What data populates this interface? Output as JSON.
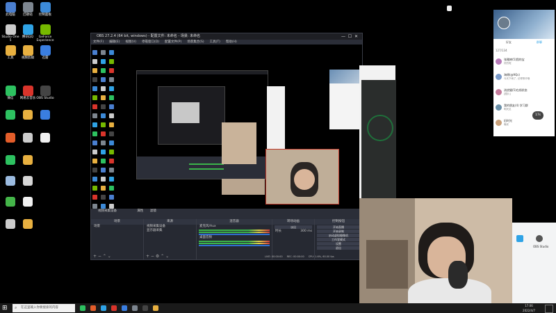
{
  "desktop": {
    "icons": [
      {
        "label": "此电脑",
        "color": "#4a7fd0",
        "icon": "computer-icon"
      },
      {
        "label": "回收站",
        "color": "#7d8690",
        "icon": "recycle-bin-icon"
      },
      {
        "label": "控制面板",
        "color": "#3c8ad8",
        "icon": "control-panel-icon"
      },
      {
        "label": "Studio One\n5",
        "color": "#cccccc",
        "icon": "studio-one-icon"
      },
      {
        "label": "腾讯QQ",
        "color": "#2fa3e6",
        "icon": "qq-icon"
      },
      {
        "label": "GeForce\nExperience",
        "color": "#76b900",
        "icon": "geforce-icon"
      },
      {
        "label": "工具",
        "color": "#e8b040",
        "icon": "folder-icon"
      },
      {
        "label": "视频剪辑",
        "color": "#e8b040",
        "icon": "folder-icon"
      },
      {
        "label": "迅雷",
        "color": "#3a7ee0",
        "icon": "xunlei-icon"
      },
      {
        "label": "微信",
        "color": "#2dc160",
        "icon": "wechat-icon"
      },
      {
        "label": "网易云音乐",
        "color": "#d9342b",
        "icon": "netease-music-icon"
      },
      {
        "label": "OBS Studio",
        "color": "#444444",
        "icon": "obs-icon"
      }
    ]
  },
  "obs": {
    "title": "OBS 27.2.4 (64 bit, windows) - 配置文件: 未命名 - 场景: 未命名",
    "menu": [
      "文件(F)",
      "编辑(E)",
      "视图(V)",
      "停靠窗口(D)",
      "配置文件(P)",
      "场景集合(S)",
      "工具(T)",
      "帮助(H)"
    ],
    "scene_bar_label": "视频采集设备",
    "properties_label": "属性",
    "filters_label": "滤镜",
    "docks": {
      "scenes": {
        "title": "场景",
        "items": [
          "场景"
        ]
      },
      "sources": {
        "title": "来源",
        "items": [
          "视频采集设备",
          "显示器采集"
        ]
      },
      "mixer": {
        "title": "混音器",
        "channels": [
          {
            "name": "麦克风/Aux",
            "level": "0.0 dB"
          },
          {
            "name": "桌面音频",
            "level": "0.0 dB"
          }
        ]
      },
      "transitions": {
        "title": "转场动画",
        "type": "淡出",
        "duration_label": "时长",
        "duration": "300 ms"
      },
      "controls": {
        "title": "控制按钮",
        "buttons": [
          "开始直播",
          "开始录制",
          "启动虚拟摄像机",
          "工作室模式",
          "设置",
          "退出"
        ]
      }
    },
    "status": {
      "live": "LIVE: 00:00:00",
      "rec": "REC: 00:00:00",
      "cpu": "CPU: 1.6%, 60.00 fps"
    }
  },
  "taskbar": {
    "search_placeholder": "在这里输入你要搜索的内容",
    "time": "17:06",
    "date": "2022/4/7"
  },
  "chat": {
    "tabs": [
      "好友",
      "群聊"
    ],
    "header_count": "127/134",
    "contacts": [
      {
        "name": "张雅婷(5)我的宝",
        "msg": "好的呢",
        "color": "#b77ab8"
      },
      {
        "name": "海绵(@9Qs)",
        "msg": "今天下雨了, 记得带伞哦",
        "color": "#7a9ac9"
      },
      {
        "name": "流浪猫(5)在线状态",
        "msg": "[图片]",
        "color": "#c47a9a"
      },
      {
        "name": "我的朋友(4) 学习群",
        "msg": "明天见",
        "color": "#6a8fa8"
      },
      {
        "name": "旧时光",
        "msg": "晚安",
        "color": "#c9a07a"
      }
    ],
    "badge": "17s"
  },
  "webcam_overlay": {
    "label": "OBS Studio"
  },
  "colors": {
    "obs_bg": "#2b2e38",
    "obs_dark": "#1e1f24",
    "preview_border": "#c0392b",
    "taskbar": "#1a1a1a",
    "accent": "#2fa3e6"
  }
}
